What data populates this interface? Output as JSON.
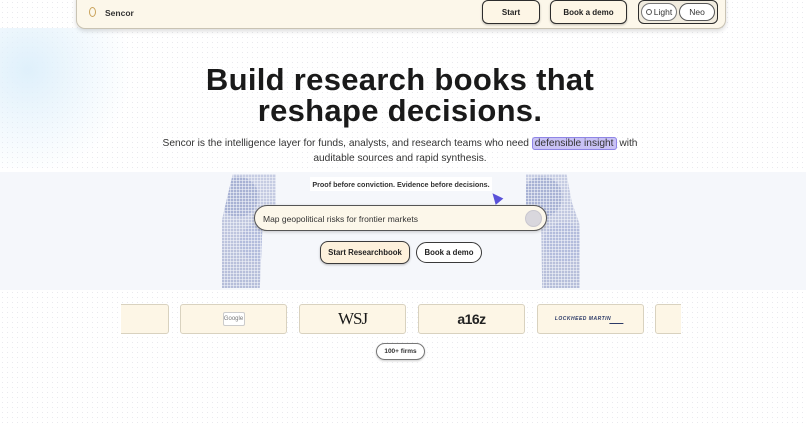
{
  "nav": {
    "brand": "Sencor",
    "start_label": "Start",
    "demo_label": "Book a demo",
    "theme_light": "Light",
    "theme_neo": "Neo"
  },
  "hero": {
    "title": "Build research books that reshape decisions.",
    "subtitle_before": "Sencor is the intelligence layer for funds, analysts, and research teams who need",
    "subtitle_highlight": "defensible insight",
    "subtitle_after": "with auditable sources and rapid synthesis.",
    "tagline": "Proof before conviction. Evidence before decisions.",
    "search_value": "Map geopolitical risks for frontier markets",
    "cta_primary": "Start Researchbook",
    "cta_secondary": "Book a demo"
  },
  "logos": {
    "items": [
      "Google",
      "WSJ",
      "a16z",
      "LOCKHEED MARTIN"
    ],
    "firms_badge": "100+ firms"
  },
  "colors": {
    "accent_highlight": "#c9c2f5",
    "cream": "#fcf7ea",
    "cursor": "#5a52d9"
  }
}
